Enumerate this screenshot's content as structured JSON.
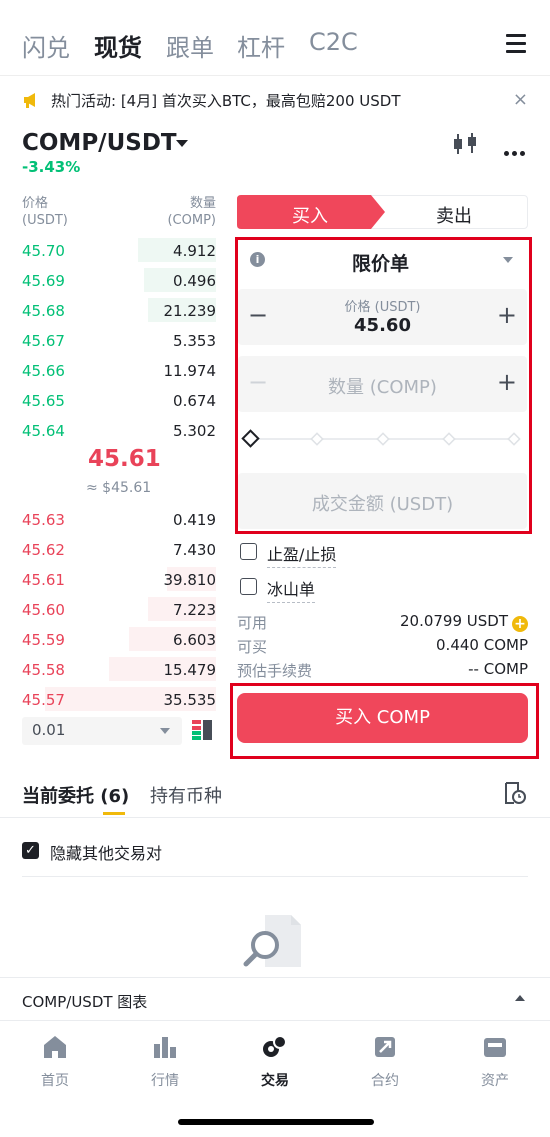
{
  "top_tabs": [
    "闪兑",
    "现货",
    "跟单",
    "杠杆",
    "C2C"
  ],
  "announcement": {
    "text": "热门活动: [4月] 首次买入BTC，最高包赔200 USDT",
    "close": "×"
  },
  "pair": {
    "name": "COMP/USDT",
    "change": "-3.43%"
  },
  "orderbook": {
    "price_header": "价格",
    "price_unit": "(USDT)",
    "qty_header": "数量",
    "qty_unit": "(COMP)",
    "bids": [
      {
        "price": "45.70",
        "qty": "4.912",
        "depth": 0.4
      },
      {
        "price": "45.69",
        "qty": "0.496",
        "depth": 0.37
      },
      {
        "price": "45.68",
        "qty": "21.239",
        "depth": 0.35
      },
      {
        "price": "45.67",
        "qty": "5.353",
        "depth": 0.0
      },
      {
        "price": "45.66",
        "qty": "11.974",
        "depth": 0.0
      },
      {
        "price": "45.65",
        "qty": "0.674",
        "depth": 0.0
      },
      {
        "price": "45.64",
        "qty": "5.302",
        "depth": 0.0
      }
    ],
    "mid_price": "45.61",
    "mid_usd": "≈ $45.61",
    "asks": [
      {
        "price": "45.63",
        "qty": "0.419",
        "depth": 0.0
      },
      {
        "price": "45.62",
        "qty": "7.430",
        "depth": 0.0
      },
      {
        "price": "45.61",
        "qty": "39.810",
        "depth": 0.25
      },
      {
        "price": "45.60",
        "qty": "7.223",
        "depth": 0.35
      },
      {
        "price": "45.59",
        "qty": "6.603",
        "depth": 0.45
      },
      {
        "price": "45.58",
        "qty": "15.479",
        "depth": 0.55
      },
      {
        "price": "45.57",
        "qty": "35.535",
        "depth": 0.88
      }
    ],
    "depth_precision": "0.01"
  },
  "trade_form": {
    "buy_tab": "买入",
    "sell_tab": "卖出",
    "order_type": "限价单",
    "price_label": "价格 (USDT)",
    "price_value": "45.60",
    "qty_placeholder": "数量 (COMP)",
    "total_placeholder": "成交金额 (USDT)",
    "tpsl_label": "止盈/止损",
    "iceberg_label": "冰山单",
    "available_label": "可用",
    "available_value": "20.0799 USDT",
    "buyable_label": "可买",
    "buyable_value": "0.440 COMP",
    "fee_label": "预估手续费",
    "fee_value": "-- COMP",
    "buy_button": "买入 COMP"
  },
  "orders": {
    "open_tab": "当前委托 (6)",
    "holdings_tab": "持有币种",
    "hide_others": "隐藏其他交易对"
  },
  "chart_bar": {
    "label": "COMP/USDT 图表"
  },
  "bottom_nav": [
    {
      "label": "首页",
      "icon": "home-icon"
    },
    {
      "label": "行情",
      "icon": "markets-icon"
    },
    {
      "label": "交易",
      "icon": "trade-icon"
    },
    {
      "label": "合约",
      "icon": "futures-icon"
    },
    {
      "label": "资产",
      "icon": "wallet-icon"
    }
  ],
  "colors": {
    "bid": "#02c076",
    "ask": "#e94359",
    "buy_button": "#f0475b",
    "accent": "#f0b90b",
    "highlight_box": "#e0001c"
  }
}
